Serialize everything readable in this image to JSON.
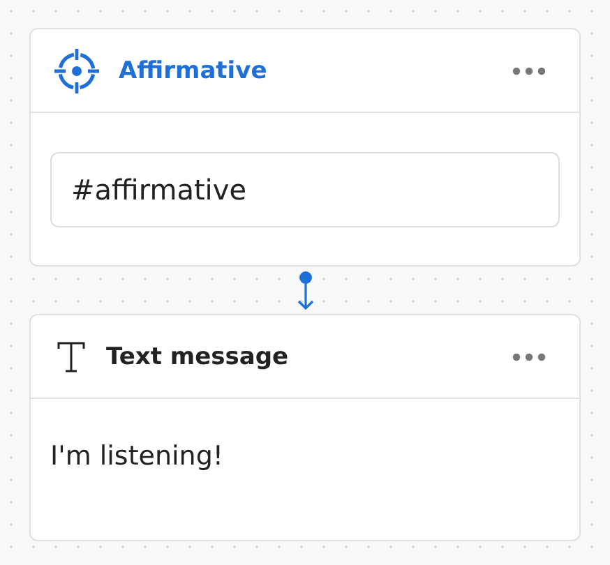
{
  "blocks": [
    {
      "kind": "intent",
      "title": "Affirmative",
      "value": "#affirmative"
    },
    {
      "kind": "text",
      "title": "Text message",
      "message": "I'm listening!"
    }
  ]
}
